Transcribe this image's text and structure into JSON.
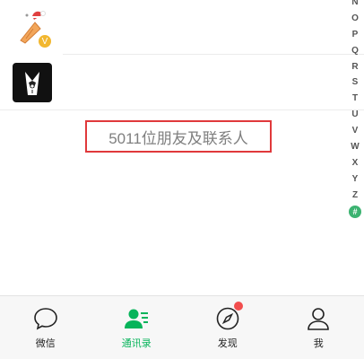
{
  "index_letters": [
    "N",
    "O",
    "P",
    "Q",
    "R",
    "S",
    "T",
    "U",
    "V",
    "W",
    "X",
    "Y",
    "Z",
    "#"
  ],
  "contact_count_text": "5011位朋友及联系人",
  "verified_symbol": "V",
  "tabs": [
    {
      "label": "微信",
      "icon": "chat-bubble-icon",
      "active": false
    },
    {
      "label": "通讯录",
      "icon": "contacts-icon",
      "active": true
    },
    {
      "label": "发现",
      "icon": "compass-icon",
      "active": false,
      "badge_dot": true
    },
    {
      "label": "我",
      "icon": "person-icon",
      "active": false
    }
  ],
  "colors": {
    "accent_green": "#07b45b",
    "badge_red": "#f24e4e",
    "highlight_border": "#e0393b",
    "verified_gold": "#f2b72f"
  }
}
